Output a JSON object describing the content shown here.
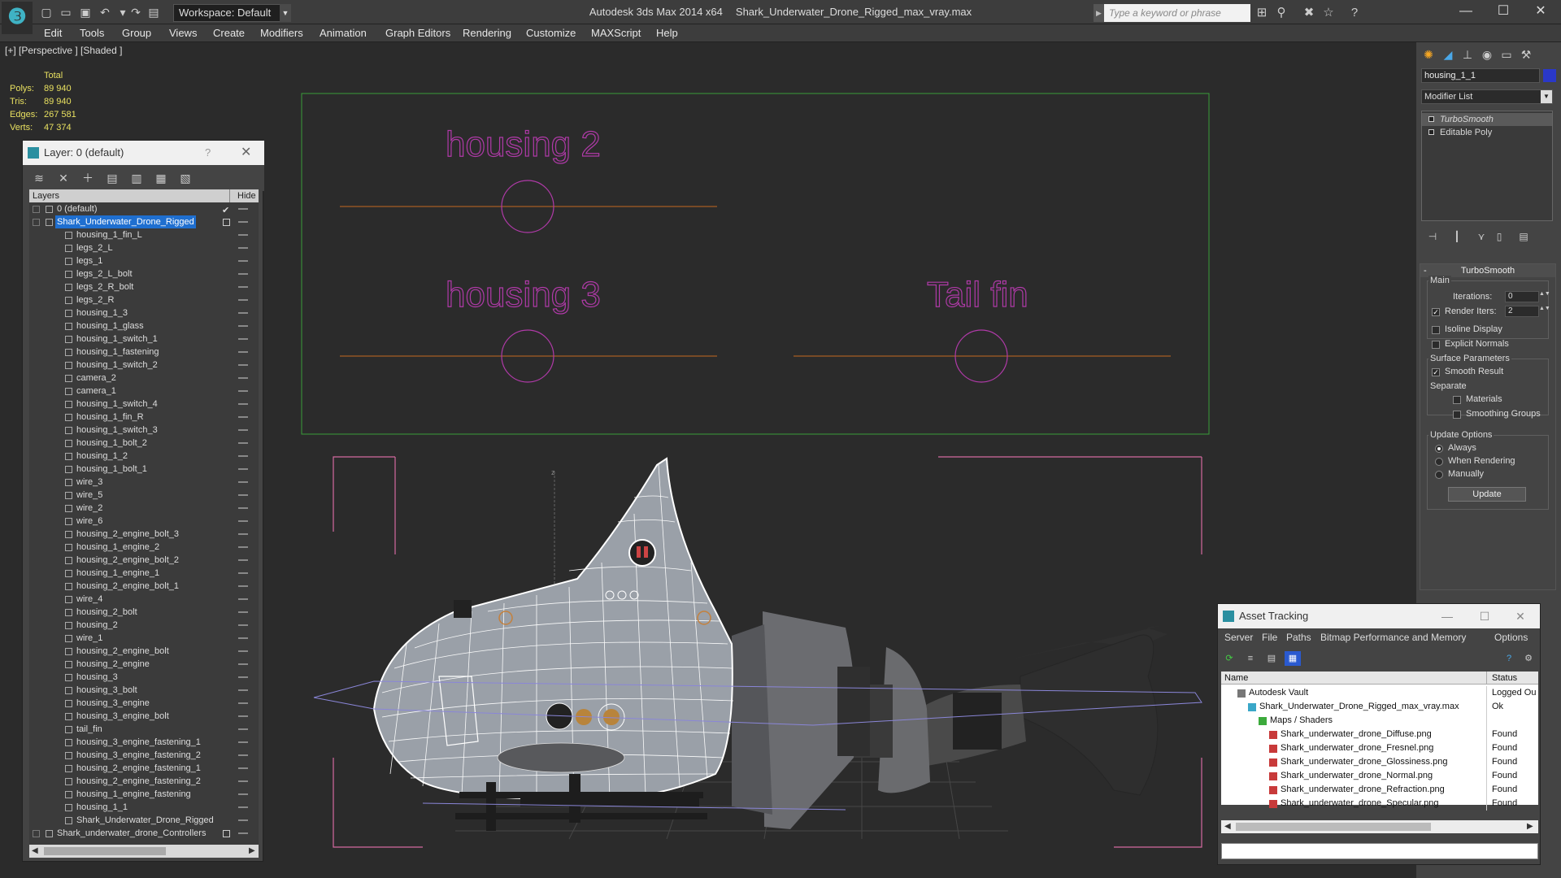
{
  "window": {
    "app_name": "Autodesk 3ds Max 2014 x64",
    "file_name": "Shark_Underwater_Drone_Rigged_max_vray.max"
  },
  "workspace": {
    "label": "Workspace: Default"
  },
  "search": {
    "placeholder": "Type a keyword or phrase"
  },
  "menu": [
    "Edit",
    "Tools",
    "Group",
    "Views",
    "Create",
    "Modifiers",
    "Animation",
    "Graph Editors",
    "Rendering",
    "Customize",
    "MAXScript",
    "Help"
  ],
  "viewport": {
    "label": "[+] [Perspective ] [Shaded ]",
    "stats_header": "Total",
    "stats": [
      {
        "k": "Polys:",
        "v": "89 940"
      },
      {
        "k": "Tris:",
        "v": "89 940"
      },
      {
        "k": "Edges:",
        "v": "267 581"
      },
      {
        "k": "Verts:",
        "v": "47 374"
      }
    ],
    "rig_labels": [
      "housing 2",
      "housing 3",
      "Tail fin"
    ]
  },
  "layer_panel": {
    "title": "Layer: 0 (default)",
    "help": "?",
    "col_layers": "Layers",
    "col_hide": "Hide",
    "rows": [
      {
        "name": "0 (default)",
        "indent": 1,
        "check": true
      },
      {
        "name": "Shark_Underwater_Drone_Rigged",
        "indent": 1,
        "selected": true,
        "box": true
      },
      {
        "name": "housing_1_fin_L",
        "indent": 2
      },
      {
        "name": "legs_2_L",
        "indent": 2
      },
      {
        "name": "legs_1",
        "indent": 2
      },
      {
        "name": "legs_2_L_bolt",
        "indent": 2
      },
      {
        "name": "legs_2_R_bolt",
        "indent": 2
      },
      {
        "name": "legs_2_R",
        "indent": 2
      },
      {
        "name": "housing_1_3",
        "indent": 2
      },
      {
        "name": "housing_1_glass",
        "indent": 2
      },
      {
        "name": "housing_1_switch_1",
        "indent": 2
      },
      {
        "name": "housing_1_fastening",
        "indent": 2
      },
      {
        "name": "housing_1_switch_2",
        "indent": 2
      },
      {
        "name": "camera_2",
        "indent": 2
      },
      {
        "name": "camera_1",
        "indent": 2
      },
      {
        "name": "housing_1_switch_4",
        "indent": 2
      },
      {
        "name": "housing_1_fin_R",
        "indent": 2
      },
      {
        "name": "housing_1_switch_3",
        "indent": 2
      },
      {
        "name": "housing_1_bolt_2",
        "indent": 2
      },
      {
        "name": "housing_1_2",
        "indent": 2
      },
      {
        "name": "housing_1_bolt_1",
        "indent": 2
      },
      {
        "name": "wire_3",
        "indent": 2
      },
      {
        "name": "wire_5",
        "indent": 2
      },
      {
        "name": "wire_2",
        "indent": 2
      },
      {
        "name": "wire_6",
        "indent": 2
      },
      {
        "name": "housing_2_engine_bolt_3",
        "indent": 2
      },
      {
        "name": "housing_1_engine_2",
        "indent": 2
      },
      {
        "name": "housing_2_engine_bolt_2",
        "indent": 2
      },
      {
        "name": "housing_1_engine_1",
        "indent": 2
      },
      {
        "name": "housing_2_engine_bolt_1",
        "indent": 2
      },
      {
        "name": "wire_4",
        "indent": 2
      },
      {
        "name": "housing_2_bolt",
        "indent": 2
      },
      {
        "name": "housing_2",
        "indent": 2
      },
      {
        "name": "wire_1",
        "indent": 2
      },
      {
        "name": "housing_2_engine_bolt",
        "indent": 2
      },
      {
        "name": "housing_2_engine",
        "indent": 2
      },
      {
        "name": "housing_3",
        "indent": 2
      },
      {
        "name": "housing_3_bolt",
        "indent": 2
      },
      {
        "name": "housing_3_engine",
        "indent": 2
      },
      {
        "name": "housing_3_engine_bolt",
        "indent": 2
      },
      {
        "name": "tail_fin",
        "indent": 2
      },
      {
        "name": "housing_3_engine_fastening_1",
        "indent": 2
      },
      {
        "name": "housing_3_engine_fastening_2",
        "indent": 2
      },
      {
        "name": "housing_2_engine_fastening_1",
        "indent": 2
      },
      {
        "name": "housing_2_engine_fastening_2",
        "indent": 2
      },
      {
        "name": "housing_1_engine_fastening",
        "indent": 2
      },
      {
        "name": "housing_1_1",
        "indent": 2
      },
      {
        "name": "Shark_Underwater_Drone_Rigged",
        "indent": 2
      },
      {
        "name": "Shark_underwater_drone_Controllers",
        "indent": 1,
        "box": true
      }
    ]
  },
  "command_panel": {
    "object_name": "housing_1_1",
    "object_color": "#2a38c8",
    "modifier_list": "Modifier List",
    "stack": [
      "TurboSmooth",
      "Editable Poly"
    ],
    "rollout_title": "TurboSmooth",
    "main_label": "Main",
    "iterations_label": "Iterations:",
    "iterations_value": "0",
    "render_iters_label": "Render Iters:",
    "render_iters_value": "2",
    "render_iters_checked": true,
    "isoline_label": "Isoline Display",
    "explicit_normals_label": "Explicit Normals",
    "surface_params_label": "Surface Parameters",
    "smooth_result_label": "Smooth Result",
    "smooth_result_checked": true,
    "separate_label": "Separate",
    "materials_label": "Materials",
    "smoothing_groups_label": "Smoothing Groups",
    "update_options_label": "Update Options",
    "update_always": "Always",
    "update_when_rendering": "When Rendering",
    "update_manually": "Manually",
    "update_button": "Update"
  },
  "asset_tracking": {
    "title": "Asset Tracking",
    "menu": [
      "Server",
      "File",
      "Paths",
      "Bitmap Performance and Memory",
      "Options"
    ],
    "col_name": "Name",
    "col_status": "Status",
    "rows": [
      {
        "name": "Autodesk Vault",
        "status": "Logged Ou",
        "level": 0,
        "icon": "vault-icon"
      },
      {
        "name": "Shark_Underwater_Drone_Rigged_max_vray.max",
        "status": "Ok",
        "level": 1,
        "icon": "max-file-icon"
      },
      {
        "name": "Maps / Shaders",
        "status": "",
        "level": 2,
        "icon": "maps-icon"
      },
      {
        "name": "Shark_underwater_drone_Diffuse.png",
        "status": "Found",
        "level": 3,
        "icon": "png-icon"
      },
      {
        "name": "Shark_underwater_drone_Fresnel.png",
        "status": "Found",
        "level": 3,
        "icon": "png-icon"
      },
      {
        "name": "Shark_underwater_drone_Glossiness.png",
        "status": "Found",
        "level": 3,
        "icon": "png-icon"
      },
      {
        "name": "Shark_underwater_drone_Normal.png",
        "status": "Found",
        "level": 3,
        "icon": "png-icon"
      },
      {
        "name": "Shark_underwater_drone_Refraction.png",
        "status": "Found",
        "level": 3,
        "icon": "png-icon"
      },
      {
        "name": "Shark_underwater_drone_Specular.png",
        "status": "Found",
        "level": 3,
        "icon": "png-icon"
      }
    ]
  },
  "colors": {
    "viewport_bg": "#2b2b2b",
    "selection": "#1f6fd0",
    "stats_text": "#e8e060",
    "rig_text": "#b03aa8",
    "bbox": "#d46aa0"
  }
}
